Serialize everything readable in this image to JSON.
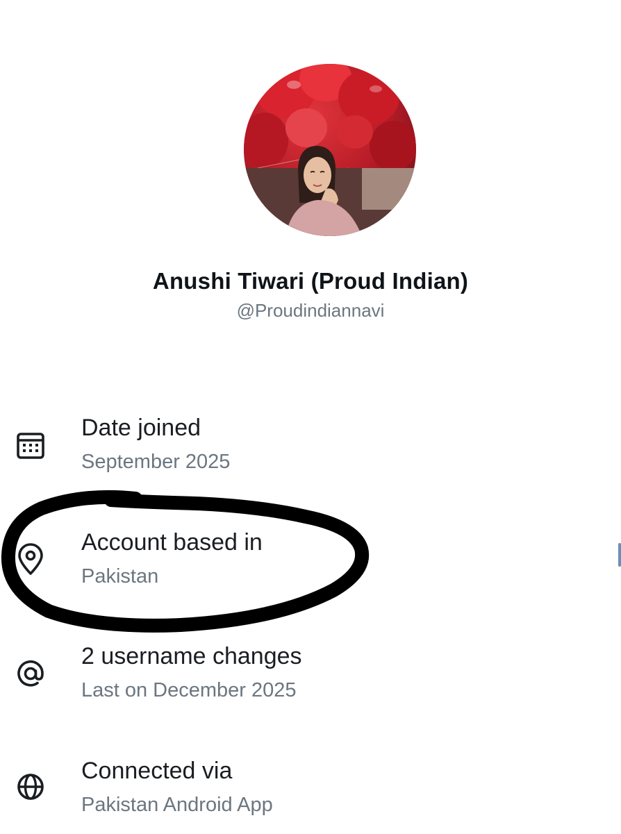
{
  "profile": {
    "display_name": "Anushi Tiwari (Proud Indian)",
    "handle": "@Proudindiannavi",
    "avatar_icon": "profile-photo"
  },
  "about": {
    "rows": [
      {
        "icon": "calendar-icon",
        "title": "Date joined",
        "value": "September 2025"
      },
      {
        "icon": "location-pin-icon",
        "title": "Account based in",
        "value": "Pakistan"
      },
      {
        "icon": "at-sign-icon",
        "title": "2 username changes",
        "value": "Last on December 2025"
      },
      {
        "icon": "globe-icon",
        "title": "Connected via",
        "value": "Pakistan Android App"
      }
    ]
  },
  "colors": {
    "primary_text": "#0f1419",
    "secondary_text": "#6b7680",
    "highlight_marker": "#000000"
  }
}
